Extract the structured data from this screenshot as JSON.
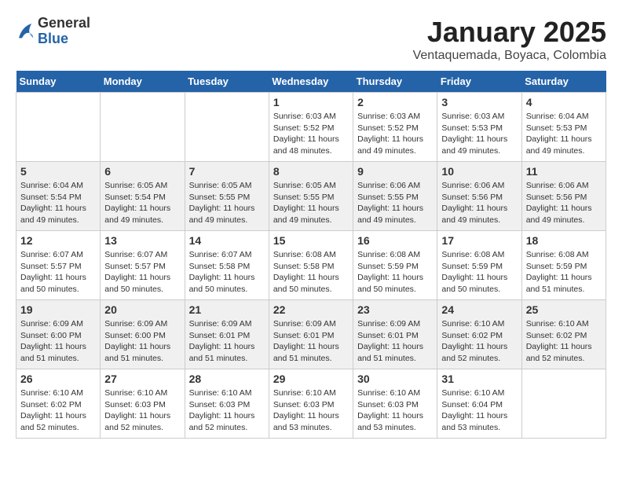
{
  "logo": {
    "general": "General",
    "blue": "Blue"
  },
  "title": "January 2025",
  "location": "Ventaquemada, Boyaca, Colombia",
  "weekdays": [
    "Sunday",
    "Monday",
    "Tuesday",
    "Wednesday",
    "Thursday",
    "Friday",
    "Saturday"
  ],
  "weeks": [
    [
      {
        "day": "",
        "info": ""
      },
      {
        "day": "",
        "info": ""
      },
      {
        "day": "",
        "info": ""
      },
      {
        "day": "1",
        "info": "Sunrise: 6:03 AM\nSunset: 5:52 PM\nDaylight: 11 hours\nand 48 minutes."
      },
      {
        "day": "2",
        "info": "Sunrise: 6:03 AM\nSunset: 5:52 PM\nDaylight: 11 hours\nand 49 minutes."
      },
      {
        "day": "3",
        "info": "Sunrise: 6:03 AM\nSunset: 5:53 PM\nDaylight: 11 hours\nand 49 minutes."
      },
      {
        "day": "4",
        "info": "Sunrise: 6:04 AM\nSunset: 5:53 PM\nDaylight: 11 hours\nand 49 minutes."
      }
    ],
    [
      {
        "day": "5",
        "info": "Sunrise: 6:04 AM\nSunset: 5:54 PM\nDaylight: 11 hours\nand 49 minutes."
      },
      {
        "day": "6",
        "info": "Sunrise: 6:05 AM\nSunset: 5:54 PM\nDaylight: 11 hours\nand 49 minutes."
      },
      {
        "day": "7",
        "info": "Sunrise: 6:05 AM\nSunset: 5:55 PM\nDaylight: 11 hours\nand 49 minutes."
      },
      {
        "day": "8",
        "info": "Sunrise: 6:05 AM\nSunset: 5:55 PM\nDaylight: 11 hours\nand 49 minutes."
      },
      {
        "day": "9",
        "info": "Sunrise: 6:06 AM\nSunset: 5:55 PM\nDaylight: 11 hours\nand 49 minutes."
      },
      {
        "day": "10",
        "info": "Sunrise: 6:06 AM\nSunset: 5:56 PM\nDaylight: 11 hours\nand 49 minutes."
      },
      {
        "day": "11",
        "info": "Sunrise: 6:06 AM\nSunset: 5:56 PM\nDaylight: 11 hours\nand 49 minutes."
      }
    ],
    [
      {
        "day": "12",
        "info": "Sunrise: 6:07 AM\nSunset: 5:57 PM\nDaylight: 11 hours\nand 50 minutes."
      },
      {
        "day": "13",
        "info": "Sunrise: 6:07 AM\nSunset: 5:57 PM\nDaylight: 11 hours\nand 50 minutes."
      },
      {
        "day": "14",
        "info": "Sunrise: 6:07 AM\nSunset: 5:58 PM\nDaylight: 11 hours\nand 50 minutes."
      },
      {
        "day": "15",
        "info": "Sunrise: 6:08 AM\nSunset: 5:58 PM\nDaylight: 11 hours\nand 50 minutes."
      },
      {
        "day": "16",
        "info": "Sunrise: 6:08 AM\nSunset: 5:59 PM\nDaylight: 11 hours\nand 50 minutes."
      },
      {
        "day": "17",
        "info": "Sunrise: 6:08 AM\nSunset: 5:59 PM\nDaylight: 11 hours\nand 50 minutes."
      },
      {
        "day": "18",
        "info": "Sunrise: 6:08 AM\nSunset: 5:59 PM\nDaylight: 11 hours\nand 51 minutes."
      }
    ],
    [
      {
        "day": "19",
        "info": "Sunrise: 6:09 AM\nSunset: 6:00 PM\nDaylight: 11 hours\nand 51 minutes."
      },
      {
        "day": "20",
        "info": "Sunrise: 6:09 AM\nSunset: 6:00 PM\nDaylight: 11 hours\nand 51 minutes."
      },
      {
        "day": "21",
        "info": "Sunrise: 6:09 AM\nSunset: 6:01 PM\nDaylight: 11 hours\nand 51 minutes."
      },
      {
        "day": "22",
        "info": "Sunrise: 6:09 AM\nSunset: 6:01 PM\nDaylight: 11 hours\nand 51 minutes."
      },
      {
        "day": "23",
        "info": "Sunrise: 6:09 AM\nSunset: 6:01 PM\nDaylight: 11 hours\nand 51 minutes."
      },
      {
        "day": "24",
        "info": "Sunrise: 6:10 AM\nSunset: 6:02 PM\nDaylight: 11 hours\nand 52 minutes."
      },
      {
        "day": "25",
        "info": "Sunrise: 6:10 AM\nSunset: 6:02 PM\nDaylight: 11 hours\nand 52 minutes."
      }
    ],
    [
      {
        "day": "26",
        "info": "Sunrise: 6:10 AM\nSunset: 6:02 PM\nDaylight: 11 hours\nand 52 minutes."
      },
      {
        "day": "27",
        "info": "Sunrise: 6:10 AM\nSunset: 6:03 PM\nDaylight: 11 hours\nand 52 minutes."
      },
      {
        "day": "28",
        "info": "Sunrise: 6:10 AM\nSunset: 6:03 PM\nDaylight: 11 hours\nand 52 minutes."
      },
      {
        "day": "29",
        "info": "Sunrise: 6:10 AM\nSunset: 6:03 PM\nDaylight: 11 hours\nand 53 minutes."
      },
      {
        "day": "30",
        "info": "Sunrise: 6:10 AM\nSunset: 6:03 PM\nDaylight: 11 hours\nand 53 minutes."
      },
      {
        "day": "31",
        "info": "Sunrise: 6:10 AM\nSunset: 6:04 PM\nDaylight: 11 hours\nand 53 minutes."
      },
      {
        "day": "",
        "info": ""
      }
    ]
  ]
}
